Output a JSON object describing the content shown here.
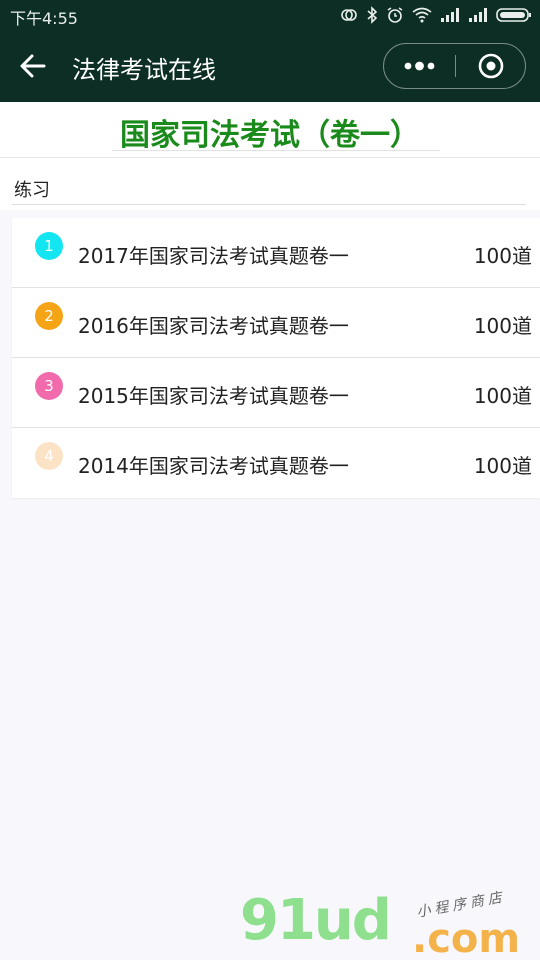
{
  "status_bar": {
    "time": "下午4:55",
    "icons": [
      "sync-icon",
      "bluetooth-icon",
      "alarm-icon",
      "wifi-icon",
      "signal-icon",
      "signal-icon",
      "battery-icon"
    ]
  },
  "nav": {
    "title": "法律考试在线",
    "back_icon": "back-arrow-icon",
    "more_icon": "more-dots-icon",
    "close_icon": "target-close-icon"
  },
  "page": {
    "title": "国家司法考试（卷一）"
  },
  "section": {
    "label": "练习"
  },
  "exams": [
    {
      "index": "1",
      "title": "2017年国家司法考试真题卷一",
      "count": "100道",
      "color": "#13e6f0"
    },
    {
      "index": "2",
      "title": "2016年国家司法考试真题卷一",
      "count": "100道",
      "color": "#f5a416"
    },
    {
      "index": "3",
      "title": "2015年国家司法考试真题卷一",
      "count": "100道",
      "color": "#f06aac"
    },
    {
      "index": "4",
      "title": "2014年国家司法考试真题卷一",
      "count": "100道",
      "color": "#fde3c6"
    }
  ],
  "watermark": {
    "logo": "91ud",
    "domain": ".com",
    "note": "小程序商店"
  },
  "colors": {
    "nav_bg": "#0c2e24",
    "headline": "#1a8a1a"
  }
}
